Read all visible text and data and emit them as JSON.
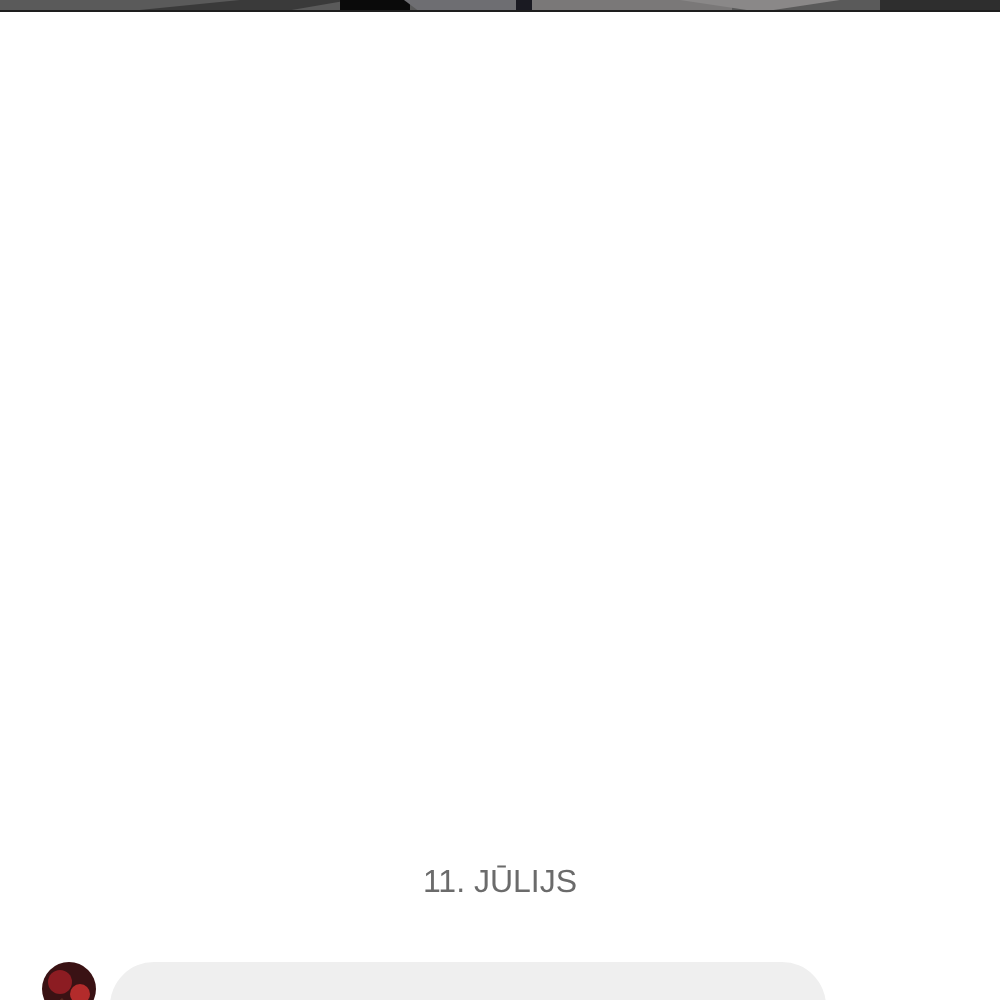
{
  "date_separator": "11. JŪLIJS",
  "messages": [
    {
      "kind": "incoming"
    }
  ]
}
